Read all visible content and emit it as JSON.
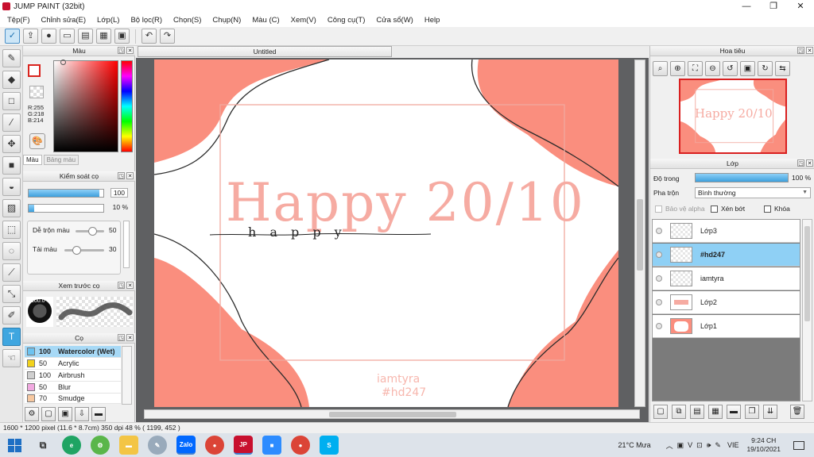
{
  "window": {
    "title": "JUMP PAINT (32bit)",
    "min": "—",
    "max": "❐",
    "close": "✕"
  },
  "menu": [
    "Tệp(F)",
    "Chỉnh sửa(E)",
    "Lớp(L)",
    "Bộ lọc(R)",
    "Chọn(S)",
    "Chụp(N)",
    "Màu (C)",
    "Xem(V)",
    "Công cụ(T)",
    "Cửa sổ(W)",
    "Help"
  ],
  "toolbar_icons": [
    "check-icon",
    "share-icon",
    "comment-icon",
    "message-icon",
    "page-icon",
    "layers-doc-icon",
    "grid-settings-icon",
    "undo-icon",
    "redo-icon"
  ],
  "tools": [
    "brush-icon",
    "eraser-icon",
    "rectangle-select-icon",
    "magic-wand-icon",
    "move-icon",
    "fill-rect-icon",
    "bucket-icon",
    "gradient-icon",
    "dotted-select-icon",
    "lasso-icon",
    "eyedropper-icon",
    "transform-icon",
    "selection-pen-icon",
    "text-icon",
    "hand-icon"
  ],
  "color_panel": {
    "title": "Màu",
    "r": "R:255",
    "g": "G:218",
    "b": "B:214",
    "tab_active": "Màu",
    "tab_inactive": "Bảng màu",
    "fg_color": "#ffdad6"
  },
  "brush_control": {
    "title": "Kiểm soát cọ",
    "size_value": "100",
    "size_fill": 0.95,
    "opacity_value": "10 %",
    "opacity_fill": 0.07,
    "blend_label": "Dễ trộn màu",
    "blend_value": "50",
    "refill_label": "Tải màu",
    "refill_value": "30"
  },
  "brush_preview": {
    "title": "Xem trước cọ",
    "size_label": "100.0"
  },
  "brush_list": {
    "title": "Cọ",
    "items": [
      {
        "num": "100",
        "name": "Watercolor (Wet)",
        "color": "#6cc3f0"
      },
      {
        "num": "50",
        "name": "Acrylic",
        "color": "#f2d21b"
      },
      {
        "num": "100",
        "name": "Airbrush",
        "color": "#cfcfcf"
      },
      {
        "num": "50",
        "name": "Blur",
        "color": "#f1a9e0"
      },
      {
        "num": "70",
        "name": "Smudge",
        "color": "#f7c8a0"
      }
    ]
  },
  "document": {
    "tab": "Untitled",
    "text_happy_main": "Happy 20/10",
    "text_happy_script": "h a p p y",
    "watermark_line1": "iamtyra",
    "watermark_line2": "#hd247"
  },
  "navigator": {
    "title": "Hoa tiêu",
    "thumb_text": "Happy 20/10"
  },
  "layers_panel": {
    "title": "Lớp",
    "opacity_label": "Độ trong",
    "opacity_value": "100 %",
    "blend_label": "Pha trộn",
    "blend_value": "Bình thường",
    "protect_alpha": "Bảo vệ alpha",
    "clip": "Xén bớt",
    "lock": "Khóa",
    "layers": [
      {
        "name": "Lớp3",
        "selected": false
      },
      {
        "name": "#hd247",
        "selected": true
      },
      {
        "name": "iamtyra",
        "selected": false
      },
      {
        "name": "Lớp2",
        "selected": false
      },
      {
        "name": "Lớp1",
        "selected": false
      }
    ]
  },
  "status": "1600 * 1200 pixel   (11.6 * 8.7cm)   350 dpi   48 %   ( 1199, 452 )",
  "taskbar": {
    "weather": "21°C  Mưa",
    "lang": "VIE",
    "time": "9:24 CH",
    "date": "19/10/2021",
    "apps": [
      "Zalo",
      "FJ",
      "JP",
      "Zoom",
      "S"
    ]
  },
  "colors": {
    "salmon": "#fa8e7e",
    "pink_text": "#f6aba2",
    "accent": "#3ea0dc"
  }
}
